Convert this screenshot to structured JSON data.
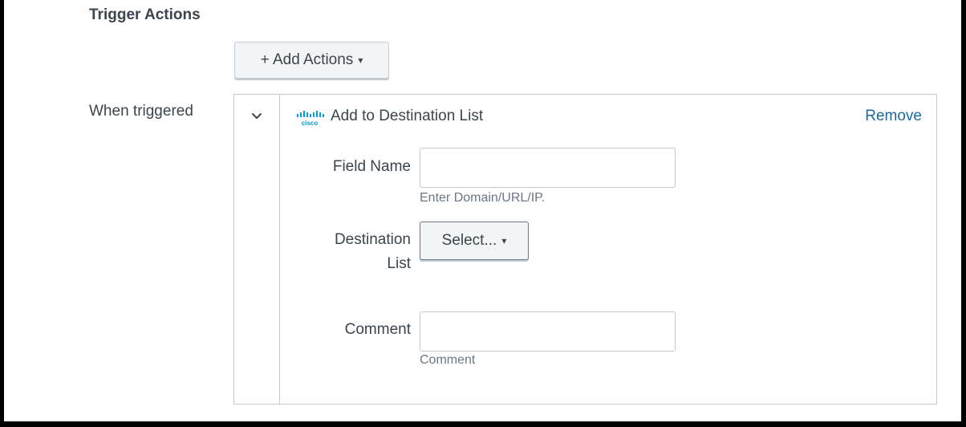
{
  "section": {
    "title": "Trigger Actions"
  },
  "add_actions": {
    "label": "+ Add Actions",
    "caret": "▾"
  },
  "when_label": "When triggered",
  "action": {
    "title": "Add to Destination List",
    "remove_label": "Remove",
    "logo_icon": "cisco-logo",
    "logo_text": "cisco",
    "logo_color": "#049fd9",
    "fields": {
      "field_name": {
        "label": "Field Name",
        "value": "",
        "placeholder": "",
        "help": "Enter Domain/URL/IP."
      },
      "destination_list": {
        "label_line1": "Destination",
        "label_line2": "List",
        "selected": "Select...",
        "caret": "▾"
      },
      "comment": {
        "label": "Comment",
        "value": "",
        "placeholder": "",
        "help": "Comment"
      }
    }
  },
  "colors": {
    "link": "#1a6aa2",
    "border": "#c3cbd4",
    "text": "#3c444d",
    "muted": "#6b7785"
  }
}
